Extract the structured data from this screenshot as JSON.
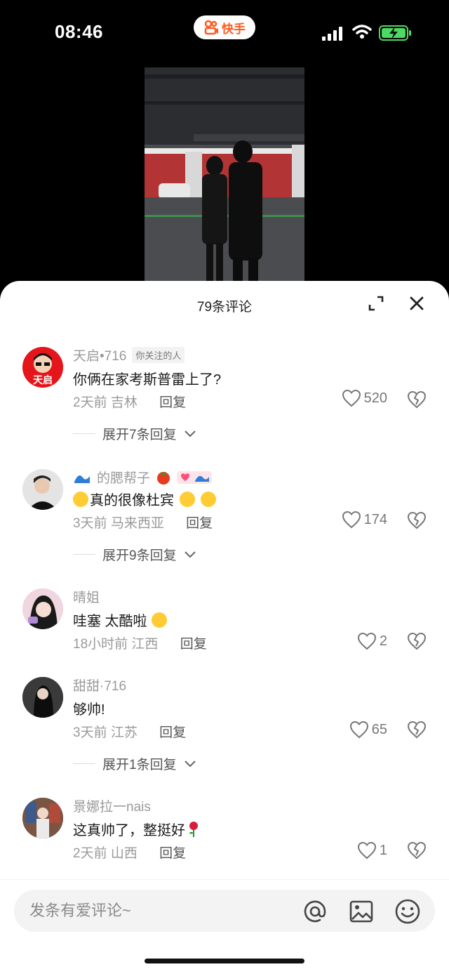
{
  "status_bar": {
    "time": "08:46",
    "app_name": "快手"
  },
  "sheet": {
    "title": "79条评论"
  },
  "comments": [
    {
      "name": "天启•716",
      "badge": "你关注的人",
      "text": "你俩在家考斯普雷上了?",
      "time": "2天前",
      "location": "吉林",
      "reply_label": "回复",
      "likes": "520",
      "expand_label": "展开7条回复"
    },
    {
      "name": "的腮帮子",
      "text": "真的很像杜宾",
      "time": "3天前",
      "location": "马来西亚",
      "reply_label": "回复",
      "likes": "174",
      "expand_label": "展开9条回复"
    },
    {
      "name": "晴姐",
      "text": "哇塞 太酷啦",
      "time": "18小时前",
      "location": "江西",
      "reply_label": "回复",
      "likes": "2"
    },
    {
      "name": "甜甜·716",
      "text": "够帅!",
      "time": "3天前",
      "location": "江苏",
      "reply_label": "回复",
      "likes": "65",
      "expand_label": "展开1条回复"
    },
    {
      "name": "景娜拉一nais",
      "text": "这真帅了，整挺好",
      "time": "2天前",
      "location": "山西",
      "reply_label": "回复",
      "likes": "1"
    }
  ],
  "input": {
    "placeholder": "发条有爱评论~"
  },
  "avatar_text": {
    "c0": "天启"
  },
  "colors": {
    "brand": "#ff5a1f",
    "battery": "#4cd964"
  }
}
